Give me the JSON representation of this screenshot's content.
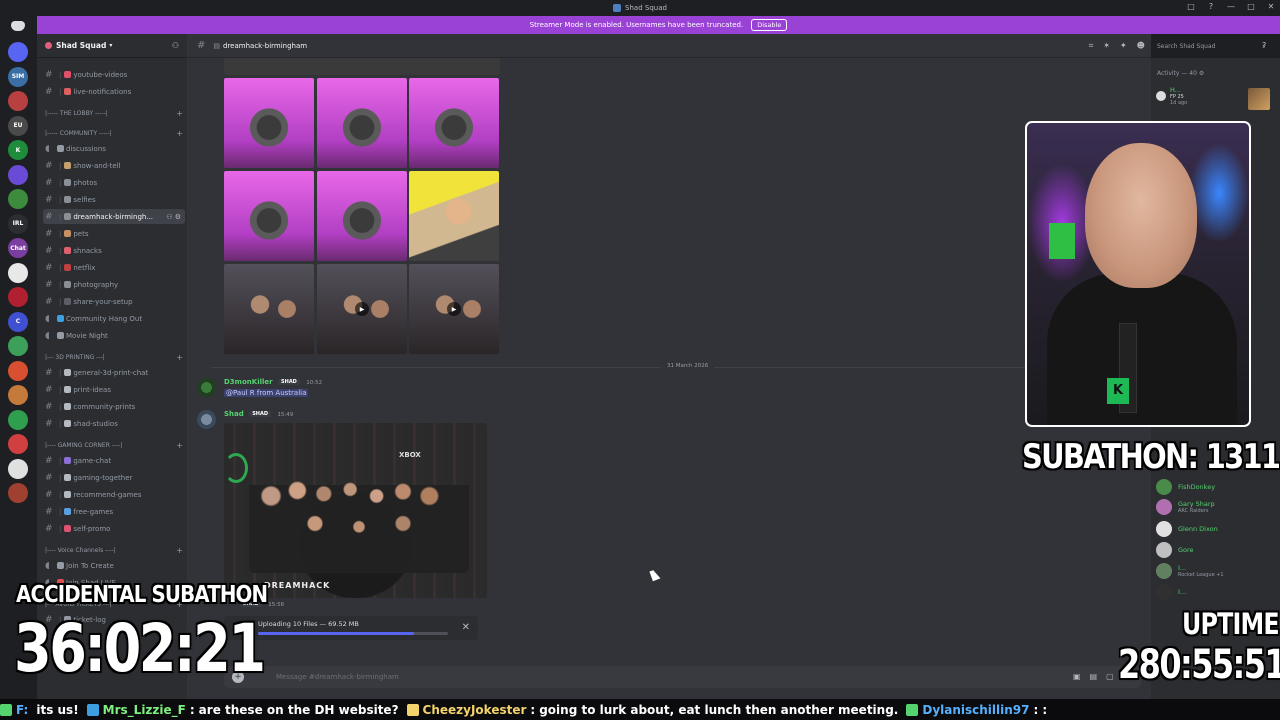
{
  "window": {
    "title": "Shad Squad",
    "controls": [
      "□",
      "?",
      "—",
      "□",
      "✕"
    ]
  },
  "banner": {
    "text": "Streamer Mode is enabled. Usernames have been truncated.",
    "button": "Disable"
  },
  "rail": {
    "servers": [
      {
        "label": "",
        "color": "#5865f2"
      },
      {
        "label": "SIM",
        "color": "#3a6ea5"
      },
      {
        "label": "",
        "color": "#b84040"
      },
      {
        "label": "EU",
        "color": "#4a4a4a"
      },
      {
        "label": "K",
        "color": "#1e8c3a"
      },
      {
        "label": "",
        "color": "#6a4bd6"
      },
      {
        "label": "",
        "color": "#3d8b3d"
      },
      {
        "label": "IRL",
        "color": "#2b2d31"
      },
      {
        "label": "Chat",
        "color": "#7a3da0"
      },
      {
        "label": "",
        "color": "#e8e8e8"
      },
      {
        "label": "",
        "color": "#b02030"
      },
      {
        "label": "C",
        "color": "#3f50d0"
      },
      {
        "label": "",
        "color": "#3ca05a"
      },
      {
        "label": "",
        "color": "#d85030"
      },
      {
        "label": "",
        "color": "#c47a3a"
      },
      {
        "label": "",
        "color": "#2f9e4f"
      },
      {
        "label": "",
        "color": "#d04040"
      },
      {
        "label": "",
        "color": "#e0e0e0"
      },
      {
        "label": "",
        "color": "#a04030"
      }
    ]
  },
  "sidebar": {
    "server_name": "Shad Squad",
    "channels": [
      {
        "type": "channel",
        "name": "youtube-videos",
        "color": "#e0506a"
      },
      {
        "type": "channel",
        "name": "live-notifications",
        "color": "#e06060"
      },
      {
        "type": "category",
        "name": "|----- THE LOBBY -----|"
      },
      {
        "type": "category",
        "name": "|----- COMMUNITY -----|"
      },
      {
        "type": "forum",
        "name": "discussions",
        "color": "#949ba4"
      },
      {
        "type": "channel",
        "name": "show-and-tell",
        "color": "#c6a06a"
      },
      {
        "type": "channel",
        "name": "photos",
        "color": "#8b8f96"
      },
      {
        "type": "channel",
        "name": "selfies",
        "color": "#8b8f96"
      },
      {
        "type": "channel",
        "name": "dreamhack-birmingh...",
        "color": "#8b8f96",
        "active": true
      },
      {
        "type": "channel",
        "name": "pets",
        "color": "#c69060"
      },
      {
        "type": "channel",
        "name": "shnacks",
        "color": "#e06070"
      },
      {
        "type": "channel",
        "name": "netflix",
        "color": "#c04040"
      },
      {
        "type": "channel",
        "name": "photography",
        "color": "#8b8f96"
      },
      {
        "type": "channel",
        "name": "share-your-setup",
        "color": "#5c5f66"
      },
      {
        "type": "voice",
        "name": "Community Hang Out",
        "color": "#3ca0e0"
      },
      {
        "type": "voice",
        "name": "Movie Night",
        "color": "#949ba4"
      },
      {
        "type": "category",
        "name": "|--- 3D PRINTING ---|"
      },
      {
        "type": "channel",
        "name": "general-3d-print-chat",
        "color": "#b5bac1"
      },
      {
        "type": "channel",
        "name": "print-ideas",
        "color": "#b5bac1"
      },
      {
        "type": "channel",
        "name": "community-prints",
        "color": "#b5bac1"
      },
      {
        "type": "channel",
        "name": "shad-studios",
        "color": "#b5bac1"
      },
      {
        "type": "category",
        "name": "|---- GAMING CORNER ----|"
      },
      {
        "type": "channel",
        "name": "game-chat",
        "color": "#8b6fd6"
      },
      {
        "type": "channel",
        "name": "gaming-together",
        "color": "#b5bac1"
      },
      {
        "type": "channel",
        "name": "recommend-games",
        "color": "#b5bac1"
      },
      {
        "type": "channel",
        "name": "free-games",
        "color": "#5aa0e0"
      },
      {
        "type": "channel",
        "name": "self-promo",
        "color": "#e05070"
      },
      {
        "type": "category",
        "name": "|---- Voice Channels ----|"
      },
      {
        "type": "voice",
        "name": "Join To Create",
        "color": "#949ba4"
      },
      {
        "type": "voice",
        "name": "Join Shad LIVE",
        "color": "#e05050"
      },
      {
        "type": "category",
        "name": "|--- AVOID TICKETS ---|"
      },
      {
        "type": "channel",
        "name": "ticket-log",
        "color": "#949ba4"
      }
    ]
  },
  "chat": {
    "channel_name": "dreamhack-birmingham",
    "date_divider": "31 March 2026",
    "messages": [
      {
        "author": "D3monKiller",
        "tag": "SHAD",
        "time": "10:52",
        "mention": "@Paul R from Australia",
        "author_color": "#55d36f"
      },
      {
        "author": "Shad",
        "tag": "SHAD",
        "time": "15:49",
        "author_color": "#55d36f"
      },
      {
        "author": "",
        "tag": "SHAD",
        "time": "15:56",
        "author_color": "#55d36f"
      }
    ],
    "photo_text": {
      "xbox": "XBOX",
      "brand": "DREAMHACK"
    },
    "upload": {
      "label": "Uploading 10 Files — 69.52 MB",
      "progress": 0.82
    },
    "composer_placeholder": "Message #dreamhack-birmingham"
  },
  "search": {
    "placeholder": "Search Shad Squad"
  },
  "members": {
    "activity_header": "Activity — 40",
    "top_member": {
      "name": "H...",
      "sub": "FP 25",
      "time": "1d ago"
    },
    "list": [
      {
        "name": "FishDonkey",
        "sub": "",
        "color": "#4a8a4a"
      },
      {
        "name": "Gary Sharp",
        "sub": "ARC Raiders",
        "color": "#b070b0"
      },
      {
        "name": "Glenn Dixon",
        "sub": "",
        "color": "#e0e0e0"
      },
      {
        "name": "Gore",
        "sub": "",
        "color": "#c0c0c0"
      },
      {
        "name": "I...",
        "sub": "Rocket League +1",
        "color": "#608060"
      },
      {
        "name": "I...",
        "sub": "",
        "color": "#303030"
      }
    ]
  },
  "overlay": {
    "subathon": "SUBATHON: 1311",
    "accidental": "ACCIDENTAL SUBATHON",
    "timer": "36:02:21",
    "uptime_label": "UPTIME",
    "uptime_value": "280:55:51"
  },
  "ticker": [
    {
      "user": "F:",
      "msg": "its us!",
      "color": "#55b0ff"
    },
    {
      "user": "Mrs_Lizzie_F",
      "msg": "are these on the DH website?",
      "color": "#7ef07e"
    },
    {
      "user": "CheezyJokester",
      "msg": "going to lurk about, eat lunch then another meeting.",
      "color": "#f3d36b"
    },
    {
      "user": "Dylanischillin97",
      "msg": ":",
      "color": "#55b0ff"
    }
  ]
}
